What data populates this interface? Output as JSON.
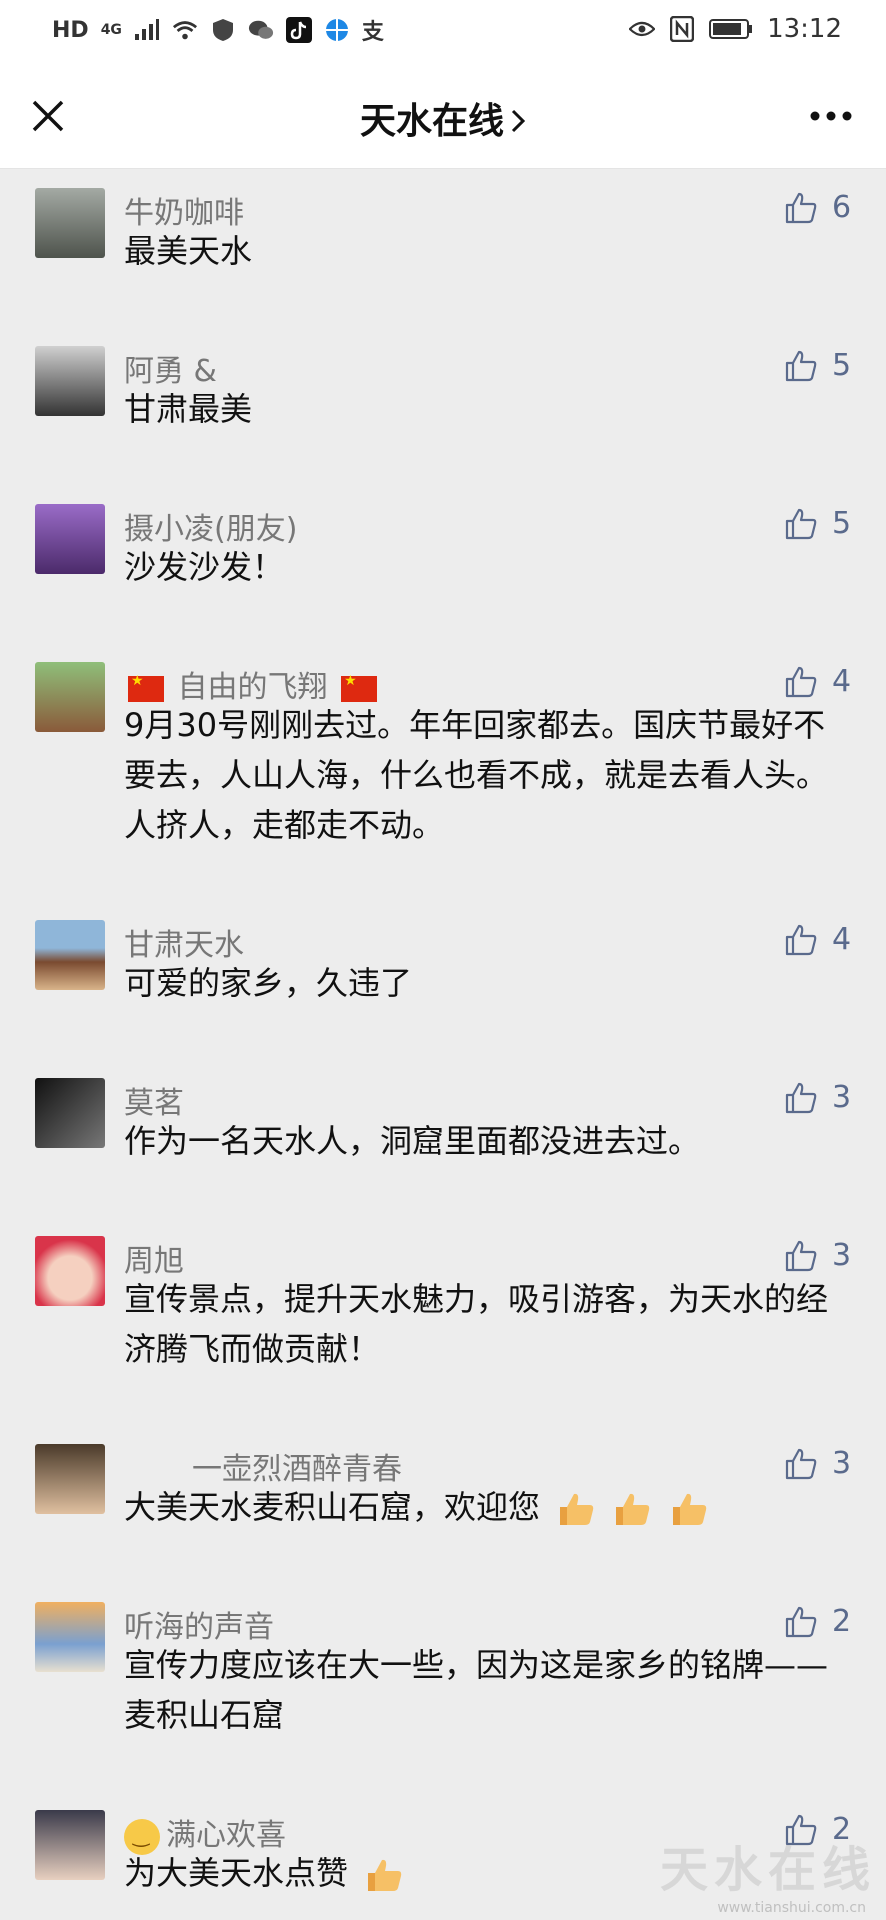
{
  "status_bar": {
    "hd": "HD",
    "signal": "4G",
    "app_zhi": "支",
    "time": "13:12"
  },
  "nav": {
    "title": "天水在线"
  },
  "comments": [
    {
      "name": "牛奶咖啡",
      "text": "最美天水",
      "likes": "6",
      "avatar_color": "#8a9088"
    },
    {
      "name": "阿勇 &",
      "text": "甘肃最美",
      "likes": "5",
      "avatar_color": "#5a5a5a"
    },
    {
      "name": "摄小凌(朋友)",
      "text": "沙发沙发！",
      "likes": "5",
      "avatar_color": "#7d4aa8"
    },
    {
      "name": "自由的飞翔",
      "text": "9月30号刚刚去过。年年回家都去。国庆节最好不要去，人山人海，什么也看不成，就是去看人头。人挤人，走都走不动。",
      "likes": "4",
      "avatar_color": "#9c7d55"
    },
    {
      "name": "甘肃天水",
      "text": "可爱的家乡，久违了",
      "likes": "4",
      "avatar_color": "#c9a27a"
    },
    {
      "name": "莫茗",
      "text": "作为一名天水人，洞窟里面都没进去过。",
      "likes": "3",
      "avatar_color": "#2f2f2f"
    },
    {
      "name": "周旭",
      "text": "宣传景点，提升天水魅力，吸引游客，为天水的经济腾飞而做贡献！",
      "likes": "3",
      "avatar_color": "#e4b3a6"
    },
    {
      "name": "一壶烈酒醉青春",
      "text": "大美天水麦积山石窟，欢迎您",
      "likes": "3",
      "avatar_color": "#6b5a4a"
    },
    {
      "name": "听海的声音",
      "text": "宣传力度应该在大一些，因为这是家乡的铭牌——麦积山石窟",
      "likes": "2",
      "avatar_color": "#b58c5e"
    },
    {
      "name": "满心欢喜",
      "text": "为大美天水点赞",
      "likes": "2",
      "avatar_color": "#7a8aa0"
    }
  ],
  "watermark": {
    "text": "天水在线",
    "url": "www.tianshui.com.cn"
  }
}
